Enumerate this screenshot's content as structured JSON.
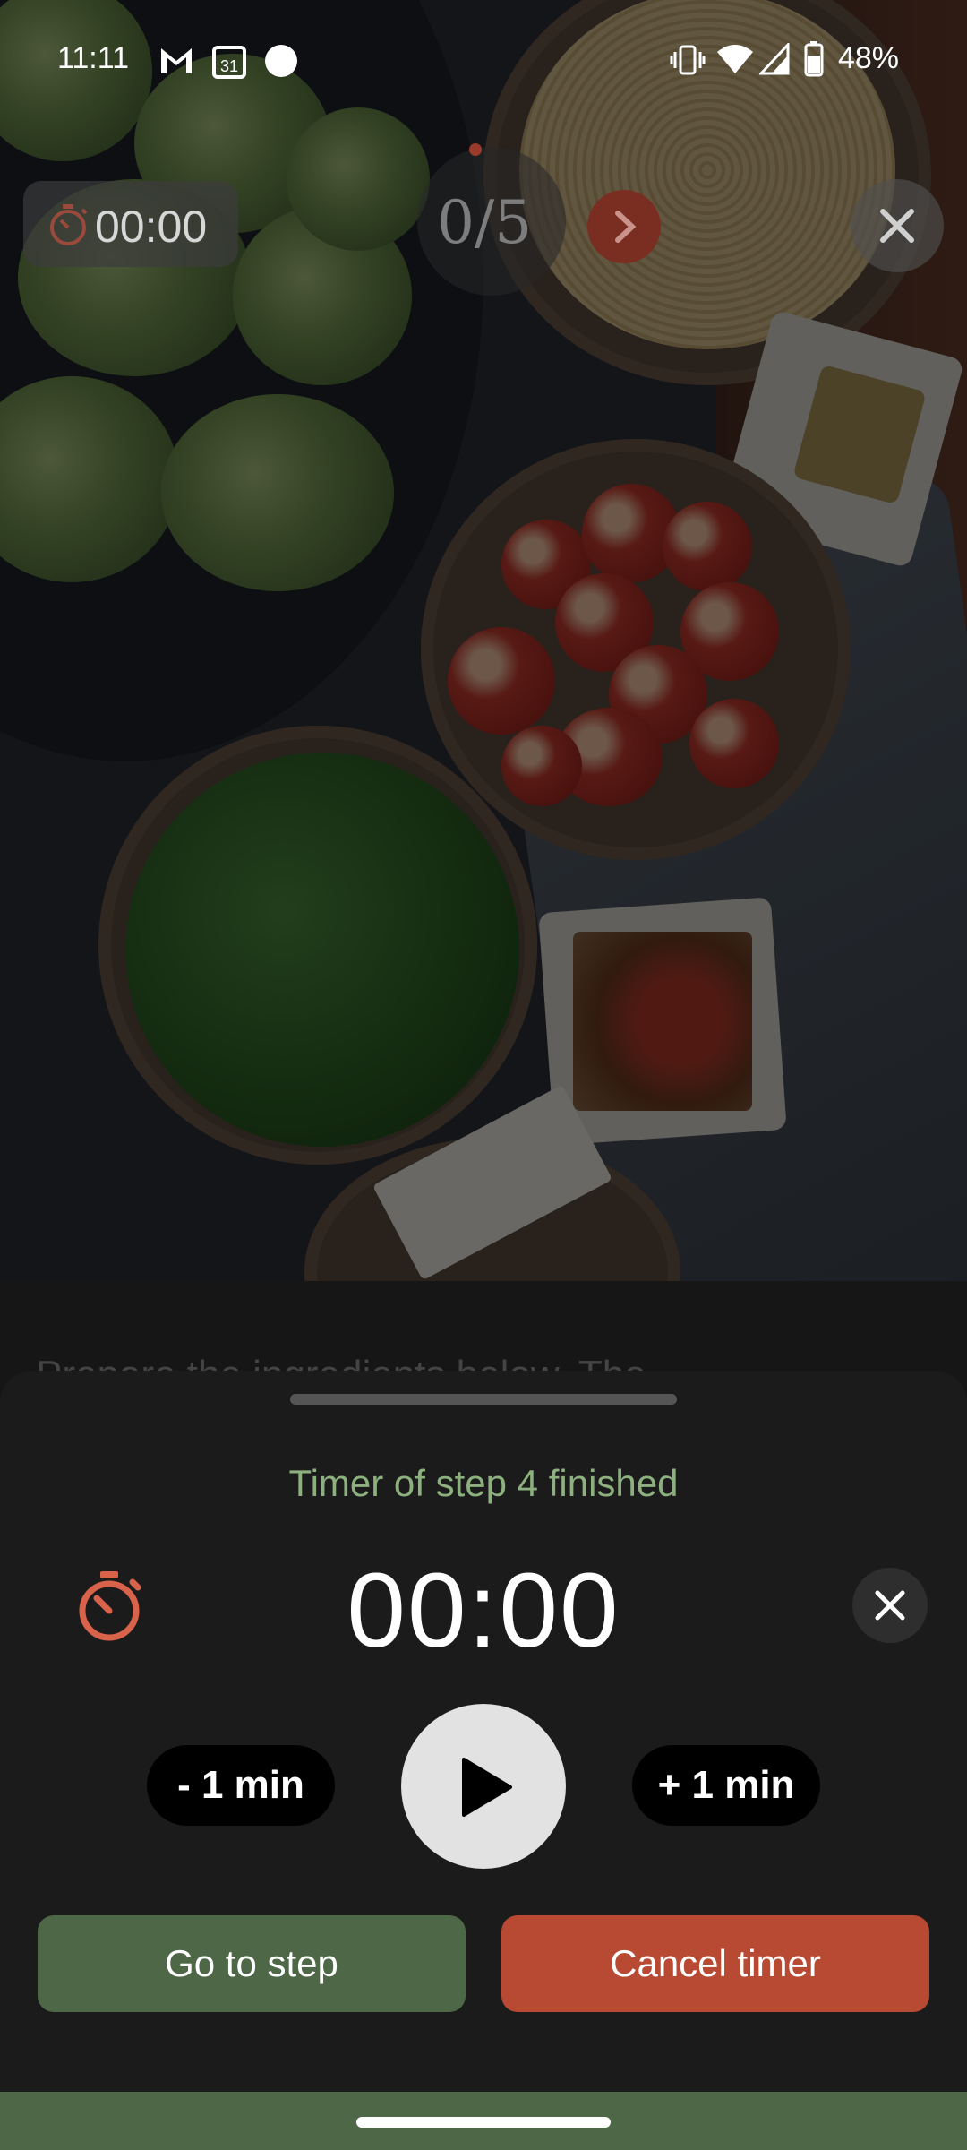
{
  "status_bar": {
    "time": "11:11",
    "calendar_day": "31",
    "battery": "48%",
    "icons": [
      "gmail-icon",
      "calendar-icon",
      "circle-icon",
      "vibrate-icon",
      "wifi-icon",
      "signal-icon",
      "battery-icon"
    ]
  },
  "step_header": {
    "timer_chip_value": "00:00",
    "step_counter": "0/5"
  },
  "step_preview_text": "Prepare the ingredients below. The",
  "timer_sheet": {
    "title": "Timer of step 4 finished",
    "time_remaining": "00:00",
    "minus_label": "- 1 min",
    "plus_label": "+ 1 min",
    "go_to_step_label": "Go to step",
    "cancel_timer_label": "Cancel timer"
  },
  "colors": {
    "accent_red": "#b84a34",
    "accent_green": "#4e6747",
    "title_green": "#8cb07e",
    "stopwatch_red": "#d9624b"
  }
}
